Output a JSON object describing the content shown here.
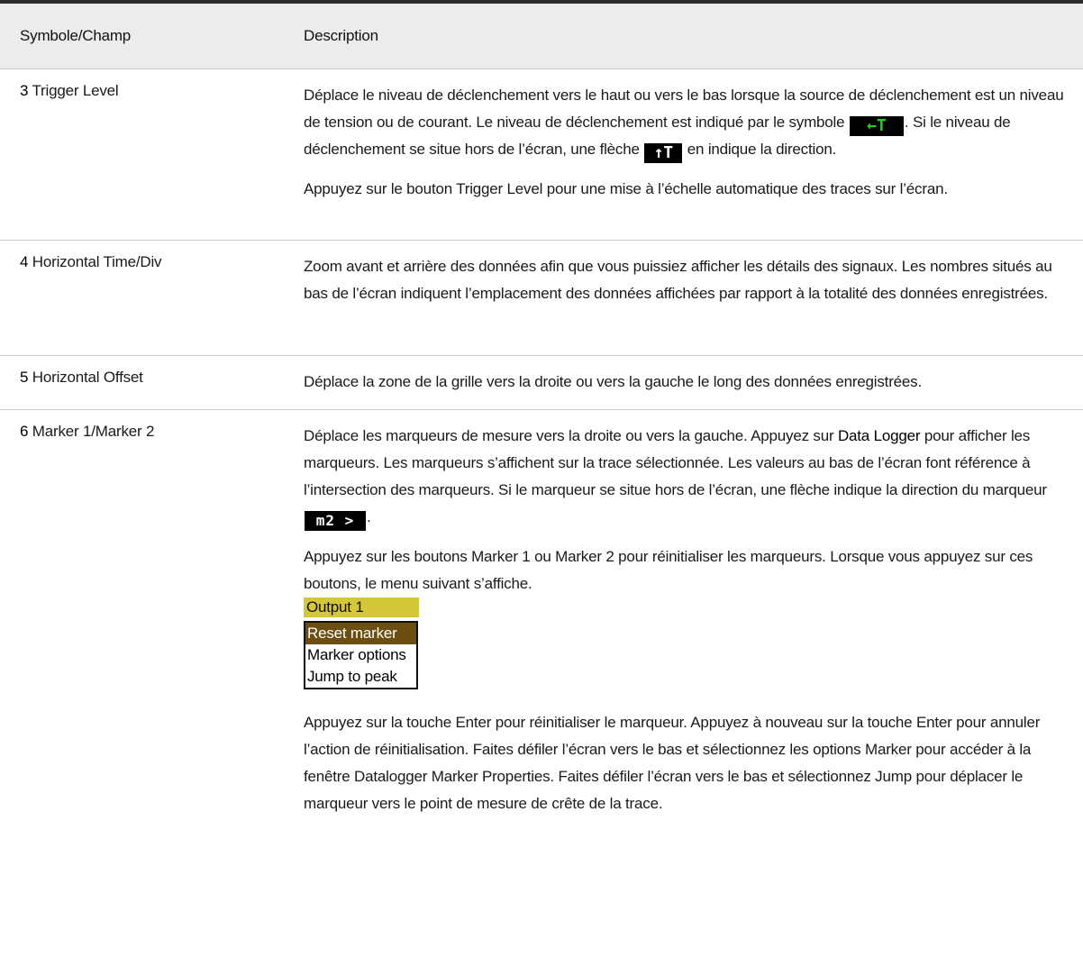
{
  "header": {
    "col1": "Symbole/Champ",
    "col2": "Description"
  },
  "rows": [
    {
      "num": "3",
      "label": " Trigger Level",
      "p1_a": "Déplace le niveau de déclenchement vers le haut ou vers le bas lorsque la source de déclenchement est un niveau de tension ou de courant. Le niveau de déclenchement est indiqué par le symbole ",
      "icon1": "←T",
      "p1_b": ". Si le niveau de déclenchement se situe hors de l’écran, une flèche ",
      "icon2": "↑T",
      "p1_c": " en indique la direction.",
      "p2": "Appuyez sur le bouton Trigger Level pour une mise à l’échelle automatique des traces sur l’écran."
    },
    {
      "num": "4",
      "label": " Horizontal Time/Div",
      "p1": "Zoom avant et arrière des données afin que vous puissiez afficher les détails des signaux. Les nombres situés au bas de l’écran indiquent l’emplacement des données affichées par rapport à la totalité des données enregistrées."
    },
    {
      "num": "5",
      "label": " Horizontal Offset",
      "p1": "Déplace la zone de la grille vers la droite ou vers la gauche le long des données enregistrées."
    },
    {
      "num": "6",
      "label": " Marker 1/Marker 2",
      "p1_a": "Déplace les marqueurs de mesure vers la droite ou vers la gauche. Appuyez sur ",
      "p1_bold": "Data Logger",
      "p1_b": " pour afficher les marqueurs. Les marqueurs s’affichent sur la trace sélectionnée. Les valeurs au bas de l’écran font référence à l’intersection des marqueurs. Si le marqueur se situe hors de l’écran, une flèche indique la direction du marqueur ",
      "icon": "m2 >",
      "p1_c": ".",
      "p2": "Appuyez sur les boutons Marker 1 ou Marker 2 pour réinitialiser les marqueurs. Lorsque vous appuyez sur ces boutons, le menu suivant s’affiche.",
      "menu": {
        "title": "Output 1",
        "items": [
          "Reset marker",
          "Marker options",
          "Jump to peak"
        ]
      },
      "p3": "Appuyez sur la touche Enter pour réinitialiser le marqueur. Appuyez à nouveau sur la touche Enter pour annuler l’action de réinitialisation. Faites défiler l’écran vers le bas et sélectionnez les options Marker pour accéder à la fenêtre Datalogger Marker Properties. Faites défiler l’écran vers le bas et sélectionnez Jump pour déplacer le marqueur vers le point de mesure de crête de la trace."
    }
  ]
}
